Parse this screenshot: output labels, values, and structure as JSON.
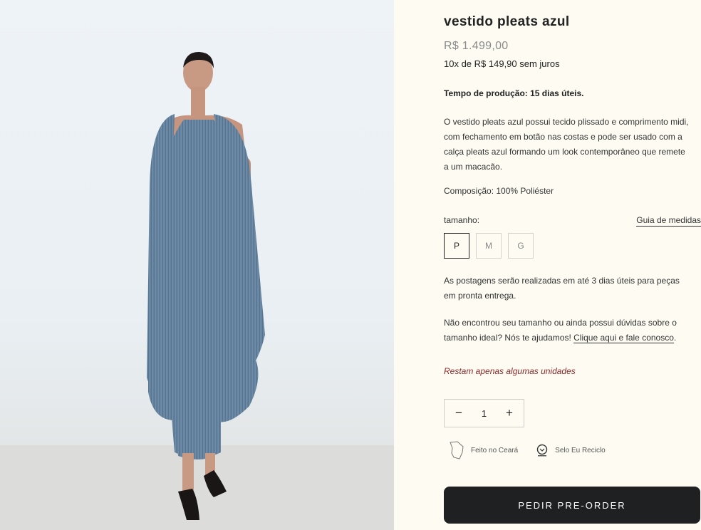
{
  "product": {
    "title": "vestido pleats azul",
    "price": "R$ 1.499,00",
    "installments": "10x de R$ 149,90 sem juros",
    "production_time": "Tempo de produção: 15 dias úteis.",
    "description": "O vestido pleats azul possui tecido plissado e comprimento midi, com fechamento em botão nas costas e pode ser usado com a calça pleats azul formando um look contemporâneo que remete a um macacão.",
    "composition": "Composição: 100% Poliéster"
  },
  "size": {
    "label": "tamanho:",
    "guide_link": "Guia de medidas",
    "options": [
      "P",
      "M",
      "G"
    ],
    "selected": "P"
  },
  "shipping_note": "As postagens serão realizadas em até 3 dias úteis para peças em pronta entrega.",
  "help": {
    "text": "Não encontrou seu tamanho ou ainda possui dúvidas sobre o tamanho ideal? Nós te ajudamos!",
    "link": "Clique aqui e fale conosco",
    "after": "."
  },
  "stock_warning": "Restam apenas algumas unidades",
  "quantity": {
    "decrement": "−",
    "value": "1",
    "increment": "+"
  },
  "badges": [
    {
      "icon": "ceara-map-icon",
      "label": "Feito no Ceará"
    },
    {
      "icon": "recycle-seal-icon",
      "label": "Selo Eu Reciclo"
    }
  ],
  "order_button": "PEDIR PRE-ORDER",
  "colors": {
    "background": "#fdfbf2",
    "dress": "#6a87a3",
    "button": "#1f2022",
    "stock_warning": "#8b2a2a"
  }
}
